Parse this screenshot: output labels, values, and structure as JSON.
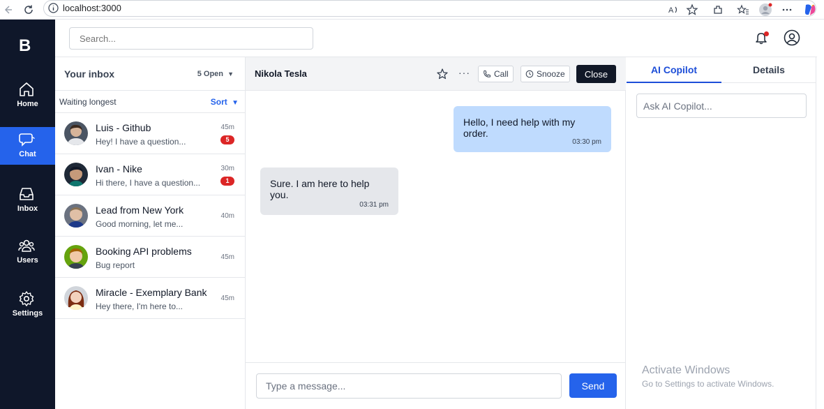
{
  "browser": {
    "url": "localhost:3000"
  },
  "nav": {
    "logo": "B",
    "items": [
      {
        "label": "Home",
        "icon": "home-icon",
        "active": false
      },
      {
        "label": "Chat",
        "icon": "chat-icon",
        "active": true
      },
      {
        "label": "Inbox",
        "icon": "inbox-icon",
        "active": false
      },
      {
        "label": "Users",
        "icon": "users-icon",
        "active": false
      },
      {
        "label": "Settings",
        "icon": "settings-icon",
        "active": false
      }
    ]
  },
  "header": {
    "search_placeholder": "Search..."
  },
  "inbox": {
    "title": "Your inbox",
    "open_count": "5 Open",
    "waiting_label": "Waiting longest",
    "sort_label": "Sort",
    "conversations": [
      {
        "name": "Luis - Github",
        "preview": "Hey! I have a question...",
        "time": "45m",
        "badge": "5"
      },
      {
        "name": "Ivan - Nike",
        "preview": "Hi there, I have a question...",
        "time": "30m",
        "badge": "1"
      },
      {
        "name": "Lead from New York",
        "preview": "Good morning, let me...",
        "time": "40m",
        "badge": ""
      },
      {
        "name": "Booking API problems",
        "preview": "Bug report",
        "time": "45m",
        "badge": ""
      },
      {
        "name": "Miracle - Exemplary Bank",
        "preview": "Hey there, I'm here to...",
        "time": "45m",
        "badge": ""
      }
    ]
  },
  "chat": {
    "contact": "Nikola Tesla",
    "call_label": "Call",
    "snooze_label": "Snooze",
    "close_label": "Close",
    "messages": [
      {
        "text": "Hello, I need help with my order.",
        "time": "03:30 pm",
        "direction": "outgoing"
      },
      {
        "text": "Sure. I am here to help you.",
        "time": "03:31 pm",
        "direction": "incoming"
      }
    ],
    "input_placeholder": "Type a message...",
    "send_label": "Send"
  },
  "right_panel": {
    "tabs": [
      "AI Copilot",
      "Details"
    ],
    "active_tab": "AI Copilot",
    "copilot_placeholder": "Ask AI Copilot..."
  },
  "watermark": {
    "title": "Activate Windows",
    "subtitle": "Go to Settings to activate Windows."
  },
  "colors": {
    "nav_bg": "#0f172a",
    "accent": "#2563eb",
    "badge": "#dc2626",
    "outgoing_bubble": "#bfdbfe",
    "incoming_bubble": "#e5e7eb"
  }
}
